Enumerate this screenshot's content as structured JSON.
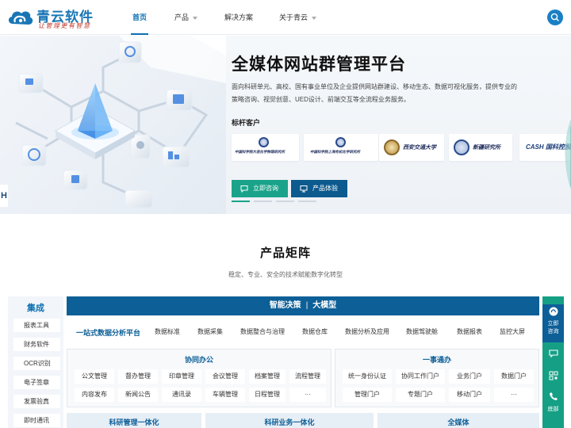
{
  "nav": {
    "logo_name": "青云软件",
    "logo_slogan": "让管理更有智慧",
    "items": [
      {
        "label": "首页",
        "active": true,
        "dropdown": false
      },
      {
        "label": "产品",
        "active": false,
        "dropdown": true
      },
      {
        "label": "解决方案",
        "active": false,
        "dropdown": false
      },
      {
        "label": "关于青云",
        "active": false,
        "dropdown": true
      }
    ],
    "search_icon": "search-icon"
  },
  "hero": {
    "title": "全媒体网站群管理平台",
    "description": "面向科研单元、高校、国有事业单位及企业提供网站群建设、移动生态、数据可视化服务，提供专业的策略咨询、视觉创意、UED设计、前端交互等全流程业务服务。",
    "clients_title": "标杆客户",
    "edge_text": "H",
    "clients": [
      {
        "name": "中国科学院大连化学物理研究所"
      },
      {
        "name": "中国科学院上海有机化学研究所"
      },
      {
        "name": "西安交通大学"
      },
      {
        "name": "新疆研究所"
      },
      {
        "name": "CASH 国科控股"
      }
    ],
    "buttons": [
      {
        "label": "立即咨询",
        "icon": "chat-icon"
      },
      {
        "label": "产品体验",
        "icon": "monitor-icon"
      }
    ],
    "slides": 4,
    "active_slide": 0
  },
  "section": {
    "title": "产品矩阵",
    "subtitle": "稳定、专业、安全的技术赋能数字化转型"
  },
  "sidebar": {
    "title": "集成",
    "items": [
      "报表工具",
      "财务软件",
      "OCR识别",
      "电子签章",
      "发票验真",
      "即时通讯"
    ]
  },
  "matrix": {
    "bar_left": "智能决策",
    "bar_sep": "|",
    "bar_right": "大模型",
    "row1_lead": "一站式数据分析平台",
    "row1_items": [
      "数据标准",
      "数据采集",
      "数据整合与治理",
      "数据仓库",
      "数据分析及应用",
      "数据驾驶舱",
      "数据报表",
      "监控大屏"
    ],
    "panel_left": {
      "title": "协同办公",
      "row1": [
        "公文管理",
        "督办管理",
        "印章管理",
        "会议管理",
        "档案管理",
        "流程管理"
      ],
      "row2": [
        "内容发布",
        "新闻公告",
        "通讯录",
        "车辆管理",
        "日程管理",
        "···"
      ]
    },
    "panel_right": {
      "title": "一事通办",
      "row1": [
        "统一身份认证",
        "协同工作门户",
        "业务门户",
        "数据门户"
      ],
      "row2": [
        "管理门户",
        "专题门户",
        "移动门户",
        "···"
      ]
    },
    "bottom": [
      "科研管理一体化",
      "科研业务一体化",
      "全媒体"
    ]
  },
  "float": {
    "consult_label": "立即咨询",
    "items": [
      "chat-icon",
      "qrcode-icon",
      "phone-icon"
    ],
    "bottom_label": "底部"
  },
  "colors": {
    "primary": "#0d5f97",
    "accent": "#1aa38a",
    "brand": "#1876b5"
  }
}
